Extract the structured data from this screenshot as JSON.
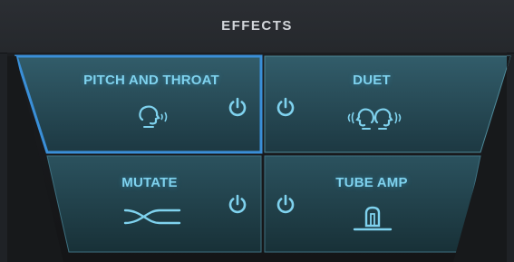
{
  "header": {
    "title": "EFFECTS"
  },
  "effects": [
    {
      "label": "PITCH AND THROAT",
      "icon": "head-profile-sound-icon",
      "selected": true
    },
    {
      "label": "DUET",
      "icon": "two-heads-sound-icon",
      "selected": false
    },
    {
      "label": "MUTATE",
      "icon": "crossing-waves-icon",
      "selected": false
    },
    {
      "label": "TUBE AMP",
      "icon": "vacuum-tube-icon",
      "selected": false
    }
  ],
  "colors": {
    "accent": "#7fd2ee",
    "selected_border": "#3a8fd8",
    "panel_fill": "#2a4a55",
    "background": "#1f2226"
  }
}
